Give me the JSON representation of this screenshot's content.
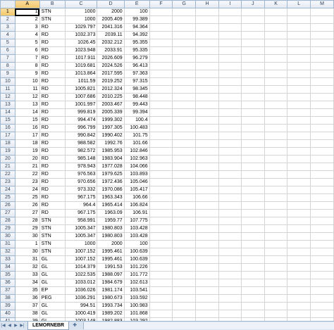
{
  "sheet": {
    "columns": [
      "A",
      "B",
      "C",
      "D",
      "E",
      "F",
      "G",
      "H",
      "I",
      "J",
      "K",
      "L",
      "M"
    ],
    "active_cell": "A1",
    "tab_name": "LEMORNEBR",
    "rows": [
      [
        "1",
        "STN",
        "1000",
        "2000",
        "100"
      ],
      [
        "2",
        "STN",
        "1000",
        "2005.409",
        "99.389"
      ],
      [
        "3",
        "RD",
        "1029.797",
        "2041.316",
        "94.364"
      ],
      [
        "4",
        "RD",
        "1032.373",
        "2039.11",
        "94.392"
      ],
      [
        "5",
        "RD",
        "1026.45",
        "2032.212",
        "95.355"
      ],
      [
        "6",
        "RD",
        "1023.948",
        "2033.91",
        "95.335"
      ],
      [
        "7",
        "RD",
        "1017.911",
        "2026.609",
        "96.279"
      ],
      [
        "8",
        "RD",
        "1019.681",
        "2024.526",
        "96.413"
      ],
      [
        "9",
        "RD",
        "1013.864",
        "2017.595",
        "97.363"
      ],
      [
        "10",
        "RD",
        "1011.59",
        "2019.252",
        "97.315"
      ],
      [
        "11",
        "RD",
        "1005.821",
        "2012.324",
        "98.345"
      ],
      [
        "12",
        "RD",
        "1007.686",
        "2010.225",
        "98.448"
      ],
      [
        "13",
        "RD",
        "1001.997",
        "2003.467",
        "99.443"
      ],
      [
        "14",
        "RD",
        "999.819",
        "2005.339",
        "99.394"
      ],
      [
        "15",
        "RD",
        "994.474",
        "1999.302",
        "100.4"
      ],
      [
        "16",
        "RD",
        "996.799",
        "1997.305",
        "100.483"
      ],
      [
        "17",
        "RD",
        "990.842",
        "1990.402",
        "101.75"
      ],
      [
        "18",
        "RD",
        "988.582",
        "1992.76",
        "101.66"
      ],
      [
        "19",
        "RD",
        "982.572",
        "1985.953",
        "102.846"
      ],
      [
        "20",
        "RD",
        "985.148",
        "1983.904",
        "102.963"
      ],
      [
        "21",
        "RD",
        "978.943",
        "1977.028",
        "104.066"
      ],
      [
        "22",
        "RD",
        "976.563",
        "1979.625",
        "103.893"
      ],
      [
        "23",
        "RD",
        "970.656",
        "1972.436",
        "105.046"
      ],
      [
        "24",
        "RD",
        "973.332",
        "1970.086",
        "105.417"
      ],
      [
        "25",
        "RD",
        "967.175",
        "1963.343",
        "106.66"
      ],
      [
        "26",
        "RD",
        "964.4",
        "1965.414",
        "106.824"
      ],
      [
        "27",
        "RD",
        "967.175",
        "1963.09",
        "106.91"
      ],
      [
        "28",
        "STN",
        "958.991",
        "1959.77",
        "107.775"
      ],
      [
        "29",
        "STN",
        "1005.347",
        "1980.803",
        "103.428"
      ],
      [
        "30",
        "STN",
        "1005.347",
        "1980.803",
        "103.428"
      ],
      [
        "1",
        "STN",
        "1000",
        "2000",
        "100"
      ],
      [
        "30",
        "STN",
        "1007.152",
        "1995.461",
        "100.639"
      ],
      [
        "31",
        "GL",
        "1007.152",
        "1995.461",
        "100.639"
      ],
      [
        "32",
        "GL",
        "1014.379",
        "1991.53",
        "101.226"
      ],
      [
        "33",
        "GL",
        "1022.535",
        "1988.097",
        "101.772"
      ],
      [
        "34",
        "GL",
        "1033.012",
        "1984.679",
        "102.613"
      ],
      [
        "35",
        "EP",
        "1036.026",
        "1981.174",
        "103.541"
      ],
      [
        "36",
        "PEG",
        "1036.291",
        "1980.673",
        "103.592"
      ],
      [
        "37",
        "GL",
        "994.51",
        "1993.734",
        "100.983"
      ],
      [
        "38",
        "GL",
        "1000.419",
        "1989.202",
        "101.868"
      ],
      [
        "39",
        "GL",
        "1003.148",
        "1982.883",
        "103.292"
      ]
    ]
  }
}
